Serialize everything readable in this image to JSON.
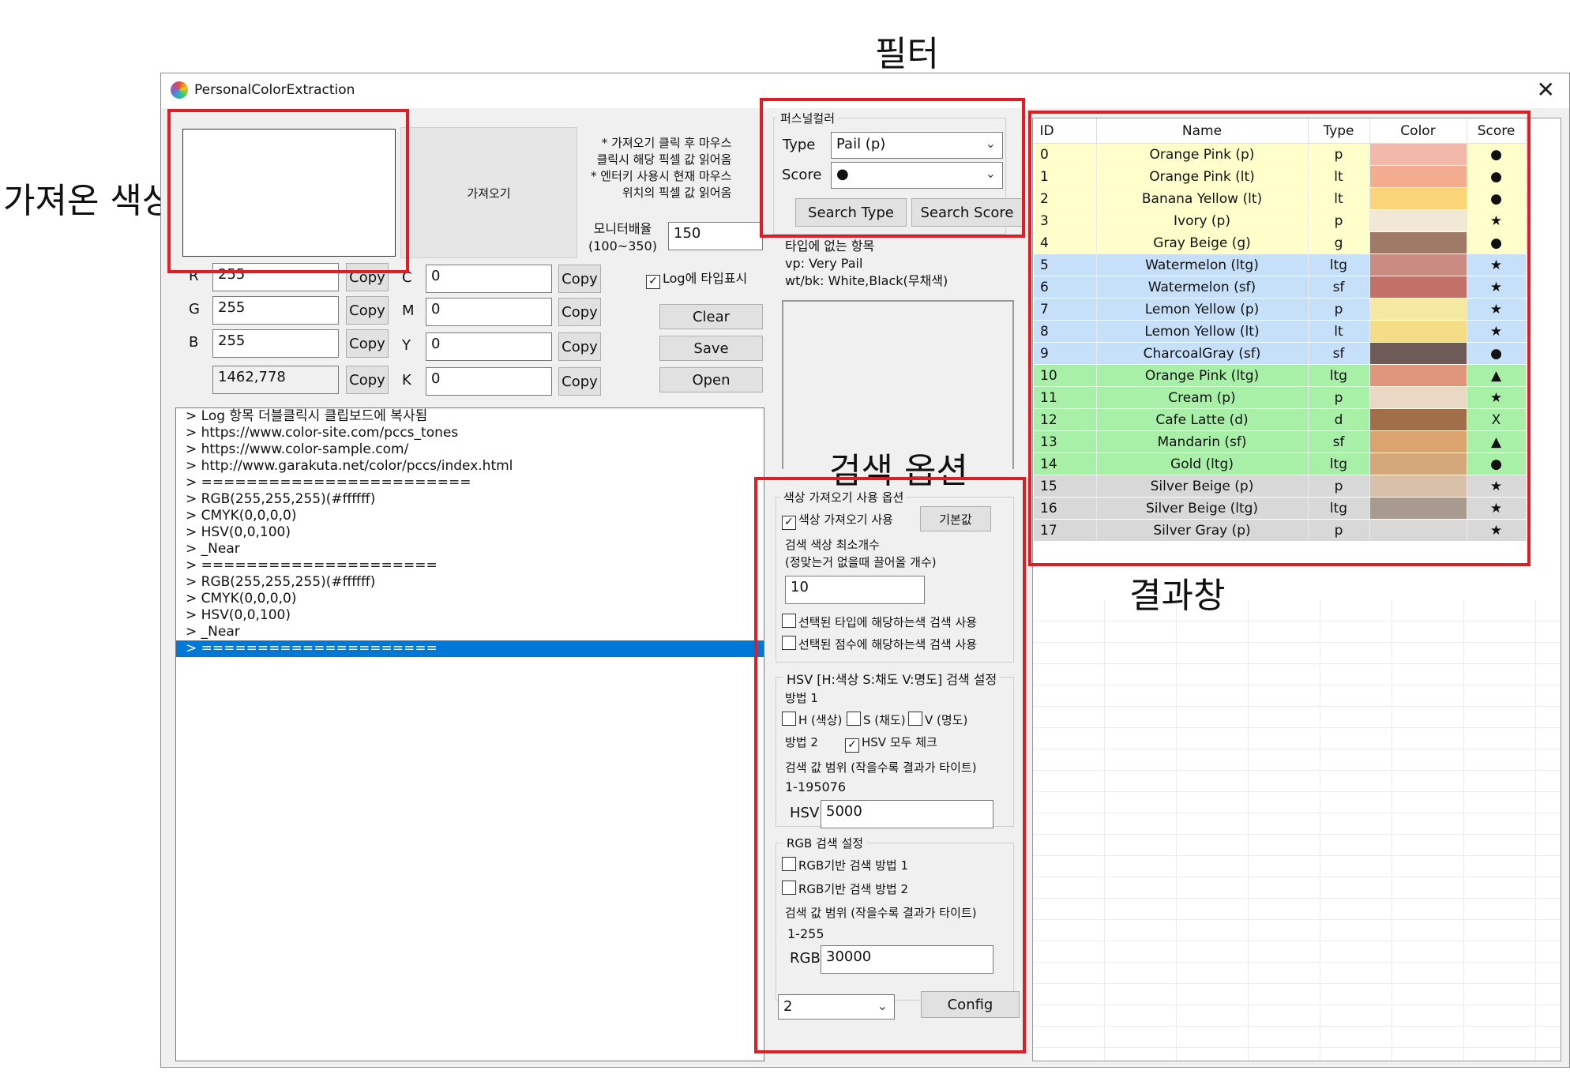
{
  "annotations": {
    "filter": "필터",
    "imported_color": "가져온 색상",
    "search_options": "검색 옵션",
    "results": "결과창"
  },
  "window": {
    "title": "PersonalColorExtraction",
    "close": "✕"
  },
  "import_panel": {
    "import_button": "가져오기",
    "hint": [
      "* 가져오기 클릭 후 마우스",
      "클릭시 해당 픽셀 값 읽어옴",
      "* 엔터키 사용시 현재 마우스",
      "위치의 픽셀 값 읽어옴"
    ],
    "monitor_label": [
      "모니터배율",
      "(100~350)"
    ],
    "monitor_value": "150",
    "log_type_label": "Log에 타입표시"
  },
  "rgb": {
    "r_label": "R",
    "r_value": "255",
    "g_label": "G",
    "g_value": "255",
    "b_label": "B",
    "b_value": "255",
    "total_value": "1462,778"
  },
  "cmyk": {
    "c_label": "C",
    "c_value": "0",
    "m_label": "M",
    "m_value": "0",
    "y_label": "Y",
    "y_value": "0",
    "k_label": "K",
    "k_value": "0"
  },
  "buttons": {
    "copy": "Copy",
    "clear": "Clear",
    "save": "Save",
    "open": "Open"
  },
  "log": [
    ">  Log 항목 더블클릭시 클립보드에 복사됨",
    ">  https://www.color-site.com/pccs_tones",
    ">  https://www.color-sample.com/",
    ">  http://www.garakuta.net/color/pccs/index.html",
    ">  ========================",
    ">  RGB(255,255,255)(#ffffff)",
    ">  CMYK(0,0,0,0)",
    ">  HSV(0,0,100)",
    ">  _Near",
    ">  =====================",
    ">  RGB(255,255,255)(#ffffff)",
    ">  CMYK(0,0,0,0)",
    ">  HSV(0,0,100)",
    ">  _Near",
    ">  ====================="
  ],
  "filter": {
    "group_title": "퍼스널컬러",
    "type_label": "Type",
    "type_value": "Pail (p)",
    "score_label": "Score",
    "score_value": "●",
    "search_type": "Search Type",
    "search_score": "Search Score",
    "note": [
      "타입에 없는 항목",
      "vp: Very Pail",
      "wt/bk: White,Black(무채색)"
    ]
  },
  "options": {
    "import_group": "색상 가져오기 사용 옵션",
    "use_import": "색상 가져오기 사용",
    "default_button": "기본값",
    "min_count_label": [
      "검색 색상 최소개수",
      "(정맞는거 없을때 끌어올 개수)"
    ],
    "min_count_value": "10",
    "use_selected_type": "선택된 타입에 해당하는색 검색 사용",
    "use_selected_score": "선택된 점수에 해당하는색 검색 사용",
    "hsv_group": "HSV [H:색상 S:채도 V:명도] 검색 설정",
    "method1": "방법 1",
    "h_label": "H (색상)",
    "s_label": "S (채도)",
    "v_label": "V (명도)",
    "method2": "방법 2",
    "hsv_all": "HSV 모두 체크",
    "hsv_range_label": "검색 값 범위 (작을수록 결과가 타이트)",
    "hsv_range": "1-195076",
    "hsv_label": "HSV",
    "hsv_value": "5000",
    "rgb_group": "RGB 검색 설정",
    "rgb_method1": "RGB기반 검색 방법 1",
    "rgb_method2": "RGB기반 검색 방법 2",
    "rgb_range_label": "검색 값 범위 (작을수록 결과가 타이트)",
    "rgb_range": "1-255",
    "rgb_label": "RGB",
    "rgb_value": "30000",
    "bottom_combo": "2",
    "config_button": "Config"
  },
  "results": {
    "headers": [
      "ID",
      "Name",
      "Type",
      "Color",
      "Score"
    ],
    "rows": [
      {
        "id": "0",
        "name": "Orange Pink (p)",
        "type": "p",
        "color": "#f2b8aa",
        "score": "●",
        "bg": "#ffffcc"
      },
      {
        "id": "1",
        "name": "Orange Pink (lt)",
        "type": "lt",
        "color": "#f3ac8e",
        "score": "●",
        "bg": "#ffffcc"
      },
      {
        "id": "2",
        "name": "Banana Yellow (lt)",
        "type": "lt",
        "color": "#f9d478",
        "score": "●",
        "bg": "#ffffcc"
      },
      {
        "id": "3",
        "name": "Ivory (p)",
        "type": "p",
        "color": "#f2e8d6",
        "score": "★",
        "bg": "#ffffcc"
      },
      {
        "id": "4",
        "name": "Gray Beige (g)",
        "type": "g",
        "color": "#a07a66",
        "score": "●",
        "bg": "#ffffcc"
      },
      {
        "id": "5",
        "name": "Watermelon (ltg)",
        "type": "ltg",
        "color": "#c98b82",
        "score": "★",
        "bg": "#c6e0fa"
      },
      {
        "id": "6",
        "name": "Watermelon (sf)",
        "type": "sf",
        "color": "#c27068",
        "score": "★",
        "bg": "#c6e0fa"
      },
      {
        "id": "7",
        "name": "Lemon Yellow (p)",
        "type": "p",
        "color": "#f5e8a0",
        "score": "★",
        "bg": "#c6e0fa"
      },
      {
        "id": "8",
        "name": "Lemon Yellow (lt)",
        "type": "lt",
        "color": "#f5dc86",
        "score": "★",
        "bg": "#c6e0fa"
      },
      {
        "id": "9",
        "name": "CharcoalGray (sf)",
        "type": "sf",
        "color": "#6e5a57",
        "score": "●",
        "bg": "#c6e0fa"
      },
      {
        "id": "10",
        "name": "Orange Pink (ltg)",
        "type": "ltg",
        "color": "#e0967a",
        "score": "▲",
        "bg": "#a8f0a8"
      },
      {
        "id": "11",
        "name": "Cream (p)",
        "type": "p",
        "color": "#e8d8c4",
        "score": "★",
        "bg": "#a8f0a8"
      },
      {
        "id": "12",
        "name": "Cafe Latte (d)",
        "type": "d",
        "color": "#a06e48",
        "score": "X",
        "bg": "#a8f0a8"
      },
      {
        "id": "13",
        "name": "Mandarin (sf)",
        "type": "sf",
        "color": "#dba46e",
        "score": "▲",
        "bg": "#a8f0a8"
      },
      {
        "id": "14",
        "name": "Gold (ltg)",
        "type": "ltg",
        "color": "#d4a87a",
        "score": "●",
        "bg": "#a8f0a8"
      },
      {
        "id": "15",
        "name": "Silver Beige (p)",
        "type": "p",
        "color": "#d8c0aa",
        "score": "★",
        "bg": "#d8d8d8"
      },
      {
        "id": "16",
        "name": "Silver Beige (ltg)",
        "type": "ltg",
        "color": "#a89a8e",
        "score": "★",
        "bg": "#d8d8d8"
      },
      {
        "id": "17",
        "name": "Silver Gray (p)",
        "type": "p",
        "color": "#d8d8d8",
        "score": "★",
        "bg": "#d8d8d8"
      }
    ]
  }
}
